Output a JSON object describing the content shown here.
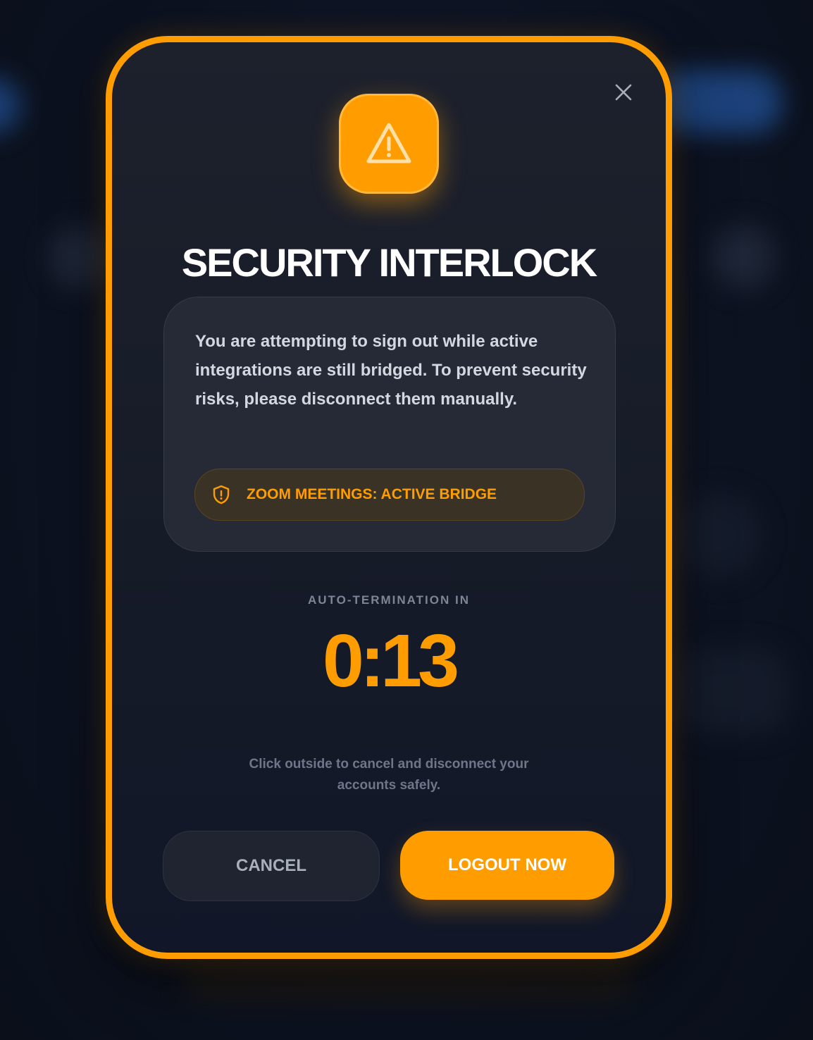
{
  "modal": {
    "title": "SECURITY INTERLOCK",
    "message": "You are attempting to sign out while active integrations are still bridged. To prevent security risks, please disconnect them manually.",
    "status": {
      "icon": "shield-alert-icon",
      "label": "ZOOM MEETINGS: ACTIVE BRIDGE"
    },
    "countdown": {
      "label": "AUTO-TERMINATION IN",
      "value": "0:13"
    },
    "hint": "Click outside to cancel and disconnect your accounts safely.",
    "buttons": {
      "cancel_label": "CANCEL",
      "logout_label": "LOGOUT NOW"
    },
    "icons": {
      "close": "close-icon",
      "warning": "warning-triangle-icon"
    }
  },
  "colors": {
    "accent": "#ff9d00",
    "background": "#0c1220",
    "panel": "#262a36",
    "text_primary": "#ffffff",
    "text_secondary": "#d3d7e0",
    "text_muted": "#7d8596"
  }
}
